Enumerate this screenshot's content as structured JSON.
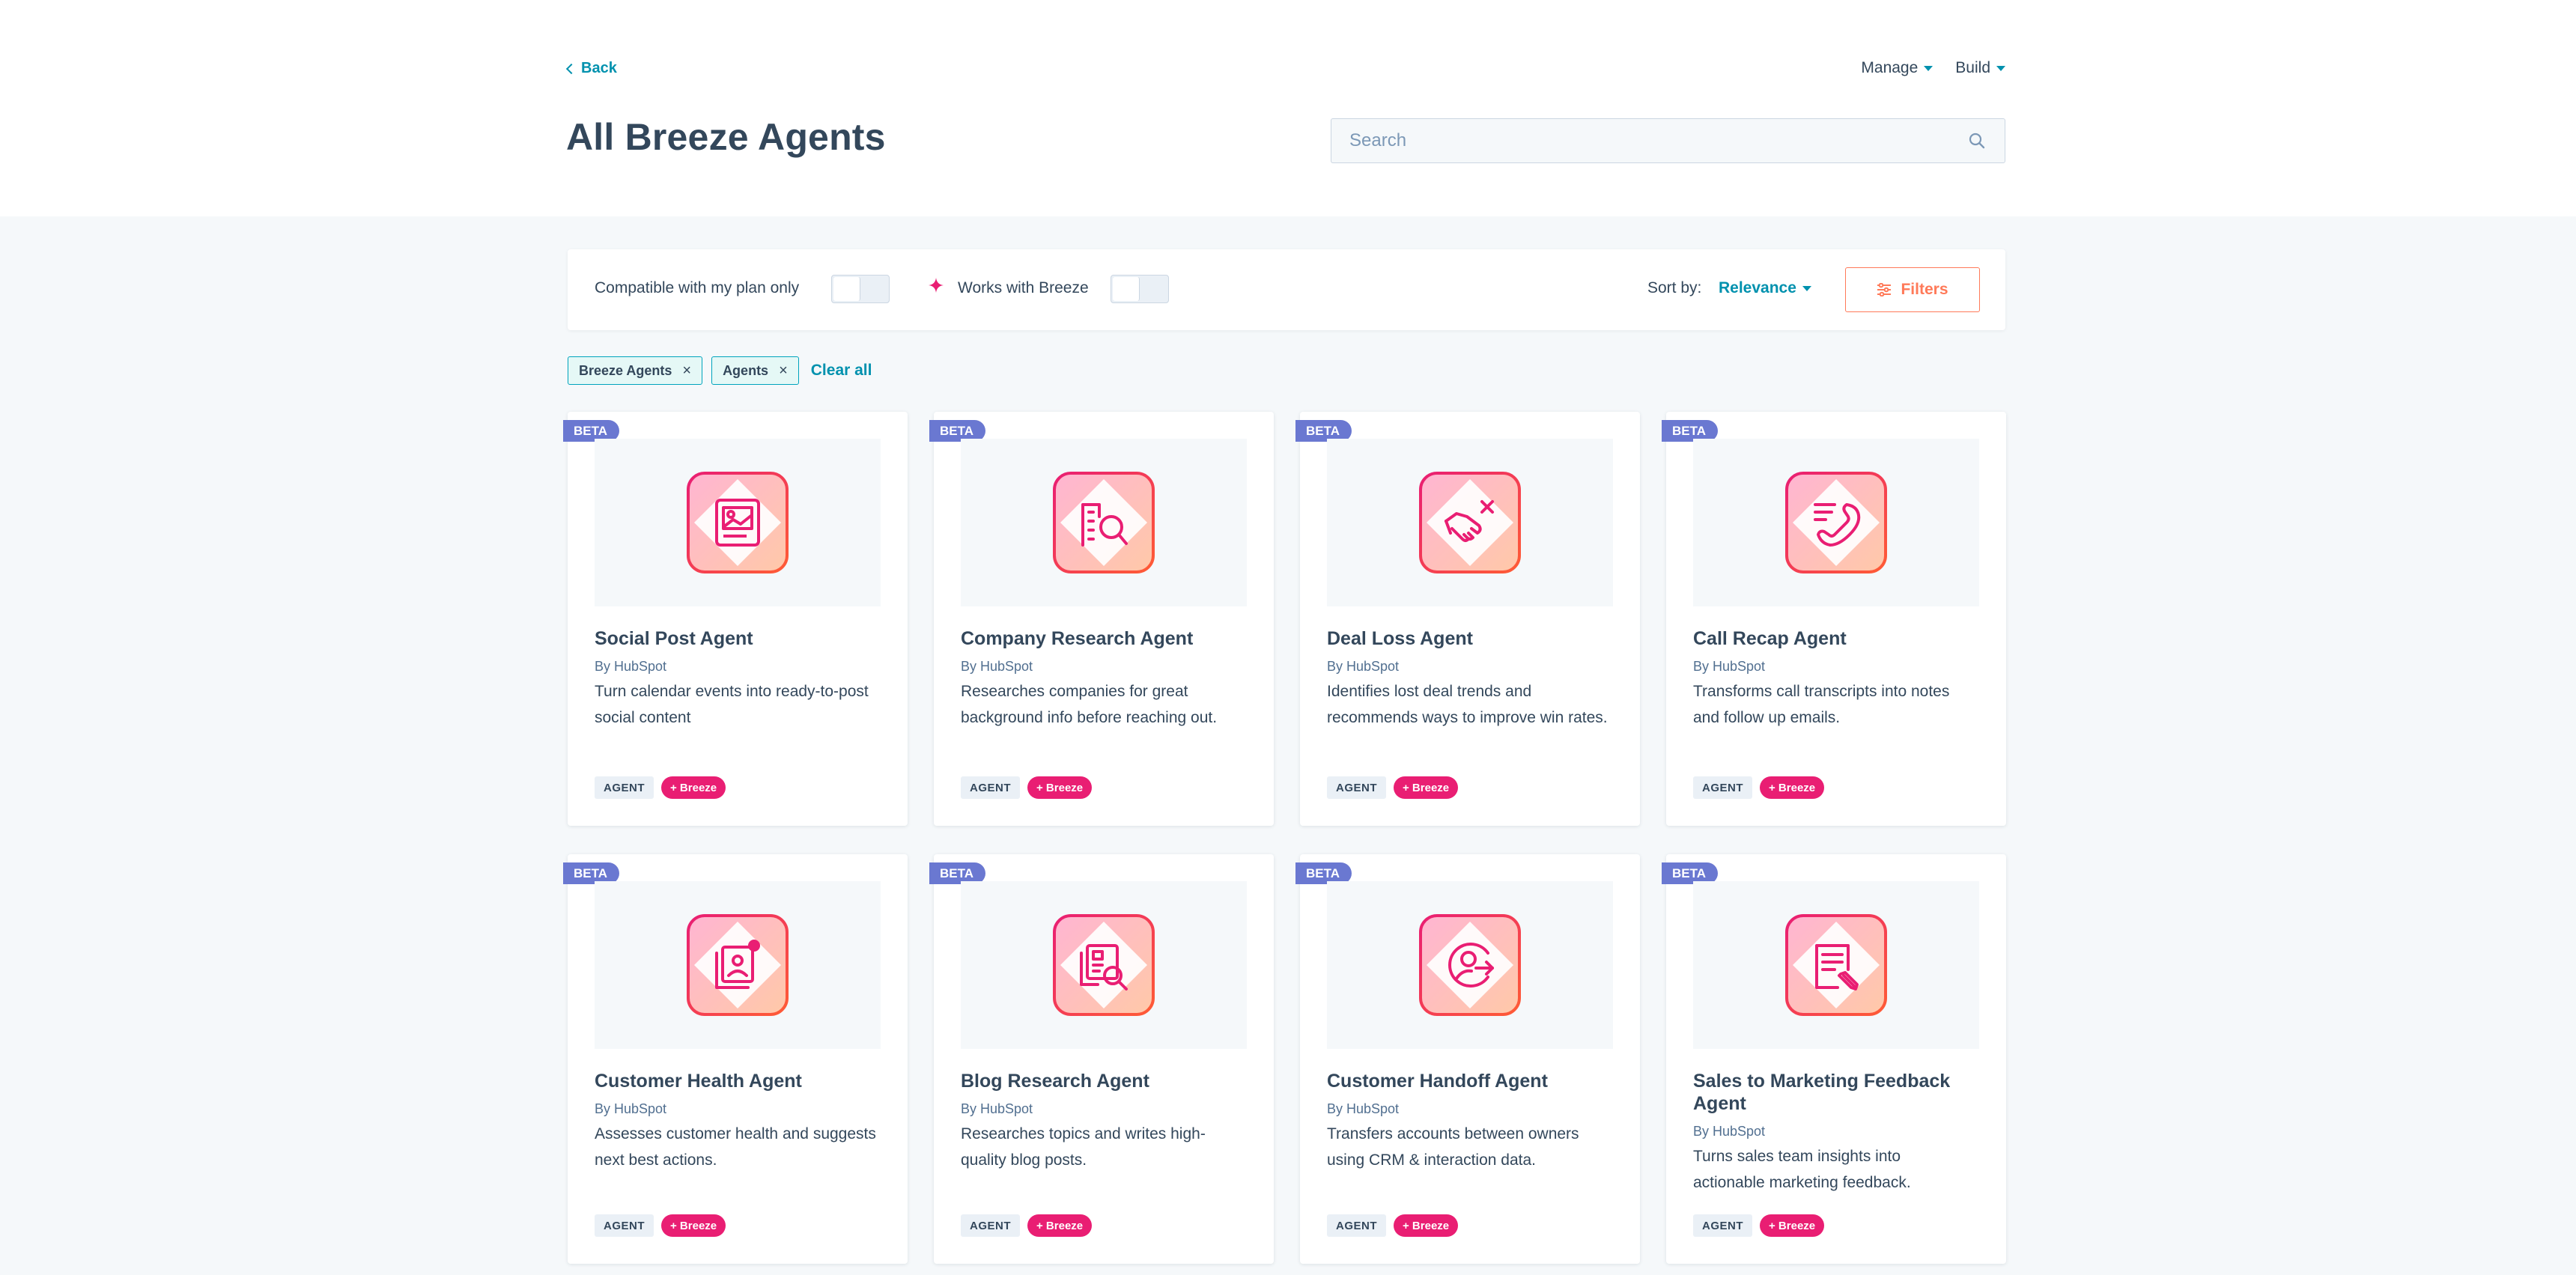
{
  "header": {
    "back_label": "Back",
    "title": "All Breeze Agents",
    "menus": [
      {
        "label": "Manage"
      },
      {
        "label": "Build"
      }
    ],
    "search_placeholder": "Search"
  },
  "filter_bar": {
    "plan_toggle_label": "Compatible with my plan only",
    "breeze_toggle_label": "Works with Breeze",
    "sort_label": "Sort by:",
    "sort_value": "Relevance",
    "filters_button": "Filters"
  },
  "active_filters": {
    "chips": [
      {
        "label": "Breeze Agents"
      },
      {
        "label": "Agents"
      }
    ],
    "clear_all": "Clear all"
  },
  "colors": {
    "accent": "#0091ae",
    "filters_orange": "#ff7a59",
    "beta_badge": "#6a78d1",
    "breeze_pink": "#e91e73"
  },
  "cards": [
    {
      "badge": "BETA",
      "name": "Social Post Agent",
      "author": "By HubSpot",
      "description": "Turn calendar events into ready-to-post social content",
      "tag": "AGENT",
      "breeze_tag": "+ Breeze",
      "icon": "social-post-icon"
    },
    {
      "badge": "BETA",
      "name": "Company Research Agent",
      "author": "By HubSpot",
      "description": "Researches companies for great background info before reaching out.",
      "tag": "AGENT",
      "breeze_tag": "+ Breeze",
      "icon": "company-research-icon"
    },
    {
      "badge": "BETA",
      "name": "Deal Loss Agent",
      "author": "By HubSpot",
      "description": "Identifies lost deal trends and recommends ways to improve win rates.",
      "tag": "AGENT",
      "breeze_tag": "+ Breeze",
      "icon": "deal-loss-icon"
    },
    {
      "badge": "BETA",
      "name": "Call Recap Agent",
      "author": "By HubSpot",
      "description": "Transforms call transcripts into notes and follow up emails.",
      "tag": "AGENT",
      "breeze_tag": "+ Breeze",
      "icon": "call-recap-icon"
    },
    {
      "badge": "BETA",
      "name": "Customer Health Agent",
      "author": "By HubSpot",
      "description": "Assesses customer health and suggests next best actions.",
      "tag": "AGENT",
      "breeze_tag": "+ Breeze",
      "icon": "customer-health-icon"
    },
    {
      "badge": "BETA",
      "name": "Blog Research Agent",
      "author": "By HubSpot",
      "description": "Researches topics and writes high-quality blog posts.",
      "tag": "AGENT",
      "breeze_tag": "+ Breeze",
      "icon": "blog-research-icon"
    },
    {
      "badge": "BETA",
      "name": "Customer Handoff Agent",
      "author": "By HubSpot",
      "description": "Transfers accounts between owners using CRM & interaction data.",
      "tag": "AGENT",
      "breeze_tag": "+ Breeze",
      "icon": "customer-handoff-icon"
    },
    {
      "badge": "BETA",
      "name": "Sales to Marketing Feedback Agent",
      "author": "By HubSpot",
      "description": "Turns sales team insights into actionable marketing feedback.",
      "tag": "AGENT",
      "breeze_tag": "+ Breeze",
      "icon": "feedback-icon"
    }
  ]
}
